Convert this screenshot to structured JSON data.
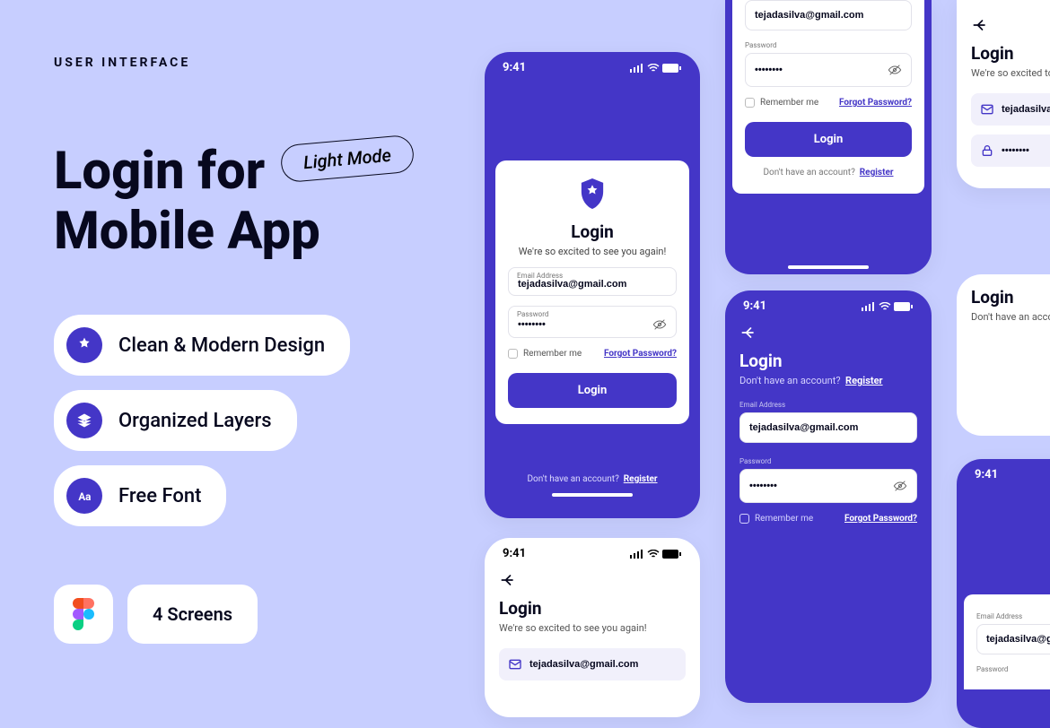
{
  "left": {
    "eyebrow": "USER INTERFACE",
    "headline1": "Login for",
    "headline2": "Mobile App",
    "mode_pill": "Light Mode",
    "features": [
      {
        "label": "Clean & Modern Design"
      },
      {
        "label": "Organized Layers"
      },
      {
        "label": "Free Font"
      }
    ],
    "screens_chip": "4 Screens"
  },
  "common": {
    "time": "9:41",
    "login_title": "Login",
    "subtitle": "We're so excited to see you again!",
    "no_account_prompt": "Don't have an account?",
    "register": "Register",
    "email_label": "Email Address",
    "password_label": "Password",
    "email_value": "tejadasilva@gmail.com",
    "email_value_crop": "tejadasilva@g",
    "password_masked": "••••••••",
    "remember": "Remember me",
    "forgot": "Forgot Password?",
    "login_btn": "Login"
  }
}
